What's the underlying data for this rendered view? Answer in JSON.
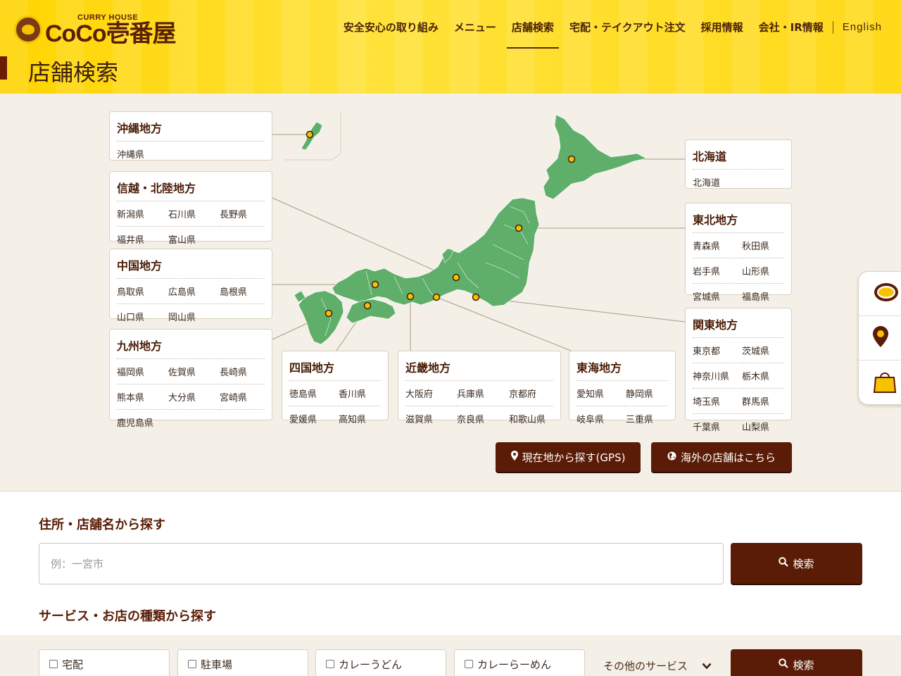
{
  "header": {
    "logo_small": "CURRY HOUSE",
    "logo_main": "CoCo壱番屋",
    "nav": [
      {
        "label": "安全安心の取り組み"
      },
      {
        "label": "メニュー"
      },
      {
        "label": "店舗検索",
        "active": true
      },
      {
        "label": "宅配・テイクアウト注文"
      },
      {
        "label": "採用情報"
      },
      {
        "label": "会社・IR情報"
      },
      {
        "label": "English"
      }
    ],
    "page_title": "店舗検索"
  },
  "regions": {
    "okinawa": {
      "title": "沖縄地方",
      "prefs": [
        "沖縄県"
      ]
    },
    "shinetsu": {
      "title": "信越・北陸地方",
      "prefs": [
        "新潟県",
        "石川県",
        "長野県",
        "福井県",
        "富山県"
      ]
    },
    "chugoku": {
      "title": "中国地方",
      "prefs": [
        "鳥取県",
        "広島県",
        "島根県",
        "山口県",
        "岡山県"
      ]
    },
    "kyushu": {
      "title": "九州地方",
      "prefs": [
        "福岡県",
        "佐賀県",
        "長崎県",
        "熊本県",
        "大分県",
        "宮崎県",
        "鹿児島県"
      ]
    },
    "shikoku": {
      "title": "四国地方",
      "prefs": [
        "徳島県",
        "香川県",
        "愛媛県",
        "高知県"
      ]
    },
    "kinki": {
      "title": "近畿地方",
      "prefs": [
        "大阪府",
        "兵庫県",
        "京都府",
        "滋賀県",
        "奈良県",
        "和歌山県"
      ]
    },
    "tokai": {
      "title": "東海地方",
      "prefs": [
        "愛知県",
        "静岡県",
        "岐阜県",
        "三重県"
      ]
    },
    "hokkaido": {
      "title": "北海道",
      "prefs": [
        "北海道"
      ]
    },
    "tohoku": {
      "title": "東北地方",
      "prefs": [
        "青森県",
        "秋田県",
        "岩手県",
        "山形県",
        "宮城県",
        "福島県"
      ]
    },
    "kanto": {
      "title": "関東地方",
      "prefs": [
        "東京都",
        "茨城県",
        "神奈川県",
        "栃木県",
        "埼玉県",
        "群馬県",
        "千葉県",
        "山梨県"
      ]
    }
  },
  "buttons": {
    "gps": "現在地から探す(GPS)",
    "overseas": "海外の店舗はこちら"
  },
  "search": {
    "address_heading": "住所・店舗名から探す",
    "placeholder": "例：一宮市",
    "search_label": "検索",
    "service_heading": "サービス・お店の種類から探す",
    "services": [
      "宅配",
      "駐車場",
      "カレーうどん",
      "カレーらーめん"
    ],
    "more_services": "その他のサービス"
  },
  "colors": {
    "header_yellow": "#ffd400",
    "brand_brown": "#5a1c06",
    "map_green": "#5fae6a",
    "pin_yellow": "#f6c200"
  }
}
